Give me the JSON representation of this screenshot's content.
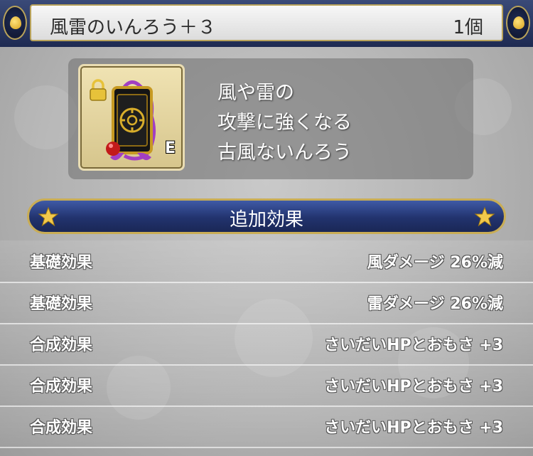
{
  "header": {
    "item_name": "風雷のいんろう＋３",
    "count": "1個"
  },
  "item": {
    "equipped_badge": "E",
    "description": [
      "風や雷の",
      "攻撃に強くなる",
      "古風ないんろう"
    ]
  },
  "section": {
    "title": "追加効果"
  },
  "effects": [
    {
      "label": "基礎効果",
      "value": "風ダメージ 26%減"
    },
    {
      "label": "基礎効果",
      "value": "雷ダメージ 26%減"
    },
    {
      "label": "合成効果",
      "value": "さいだいHPとおもさ +3"
    },
    {
      "label": "合成効果",
      "value": "さいだいHPとおもさ +3"
    },
    {
      "label": "合成効果",
      "value": "さいだいHPとおもさ +3"
    }
  ],
  "colors": {
    "header_dark": "#1e2a52",
    "banner_blue": "#22336e",
    "gold_trim": "#c9ad55",
    "icon_frame": "#e8d9a6",
    "star_gold": "#f2c94c"
  },
  "icons": {
    "header_left": "slime-drop-icon",
    "header_right": "slime-drop-icon",
    "item": "inro-charm-icon",
    "lock": "lock-icon",
    "banner_left": "star-icon",
    "banner_right": "star-icon"
  }
}
